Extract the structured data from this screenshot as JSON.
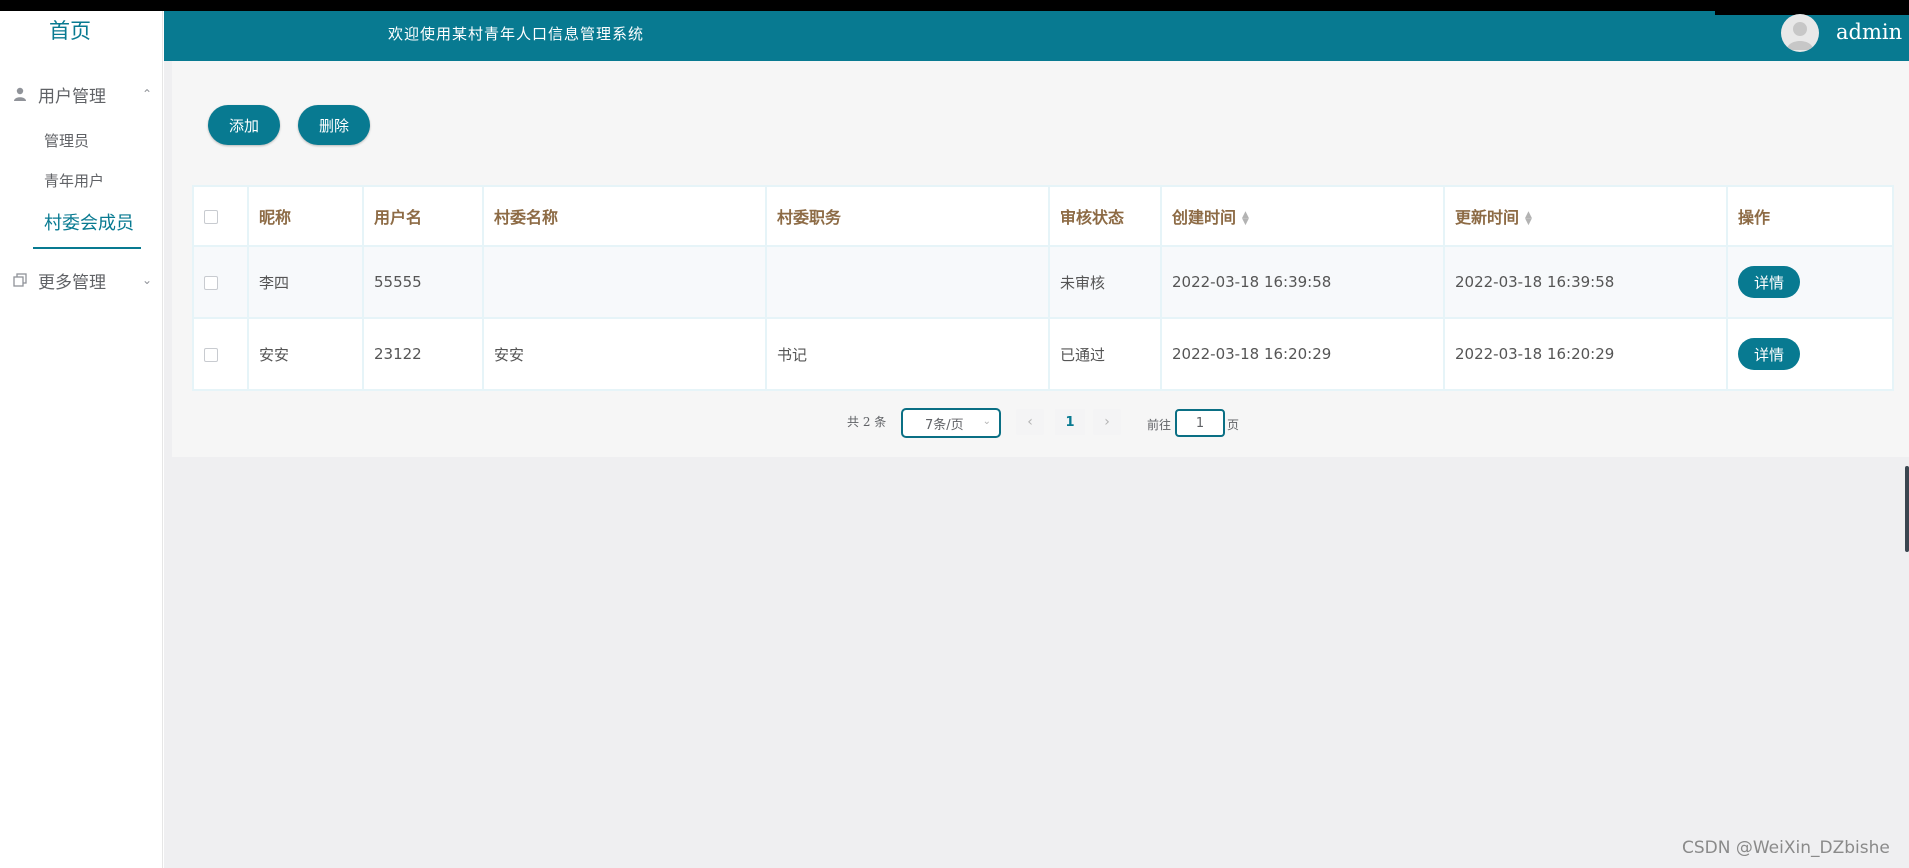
{
  "header": {
    "title": "欢迎使用某村青年人口信息管理系统",
    "username": "admin"
  },
  "sidebar": {
    "home": "首页",
    "groups": [
      {
        "label": "用户管理",
        "icon": "user-icon",
        "expanded": true
      },
      {
        "label": "更多管理",
        "icon": "copy-icon",
        "expanded": false
      }
    ],
    "items": [
      {
        "label": "管理员",
        "active": false
      },
      {
        "label": "青年用户",
        "active": false
      },
      {
        "label": "村委会成员",
        "active": true
      }
    ]
  },
  "toolbar": {
    "add_label": "添加",
    "delete_label": "删除"
  },
  "table": {
    "columns": [
      "昵称",
      "用户名",
      "村委名称",
      "村委职务",
      "审核状态",
      "创建时间",
      "更新时间",
      "操作"
    ],
    "rows": [
      {
        "nickname": "李四",
        "username": "55555",
        "committee": "",
        "position": "",
        "status": "未审核",
        "created": "2022-03-18 16:39:58",
        "updated": "2022-03-18 16:39:58",
        "action": "详情"
      },
      {
        "nickname": "安安",
        "username": "23122",
        "committee": "安安",
        "position": "书记",
        "status": "已通过",
        "created": "2022-03-18 16:20:29",
        "updated": "2022-03-18 16:20:29",
        "action": "详情"
      }
    ]
  },
  "pagination": {
    "total": "共 2 条",
    "page_size": "7条/页",
    "current_page": "1",
    "goto_label": "前往",
    "goto_value": "1",
    "page_suffix": "页"
  },
  "watermark": "CSDN @WeiXin_DZbishe",
  "colors": {
    "primary": "#087a91",
    "header_text": "#ffffff",
    "column_header": "#8d6b45"
  }
}
